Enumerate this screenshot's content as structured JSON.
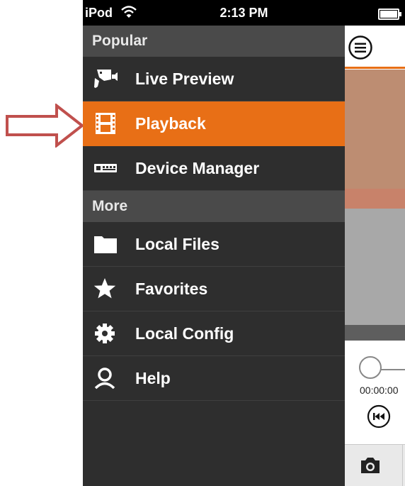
{
  "status_bar": {
    "carrier": "iPod",
    "time": "2:13 PM"
  },
  "menu": {
    "sections": [
      {
        "title": "Popular",
        "items": [
          {
            "label": "Live Preview",
            "icon": "camera-icon",
            "active": false
          },
          {
            "label": "Playback",
            "icon": "film-icon",
            "active": true
          },
          {
            "label": "Device Manager",
            "icon": "dvr-icon",
            "active": false
          }
        ]
      },
      {
        "title": "More",
        "items": [
          {
            "label": "Local Files",
            "icon": "folder-icon",
            "active": false
          },
          {
            "label": "Favorites",
            "icon": "star-icon",
            "active": false
          },
          {
            "label": "Local Config",
            "icon": "gear-icon",
            "active": false
          },
          {
            "label": "Help",
            "icon": "user-icon",
            "active": false
          }
        ]
      }
    ]
  },
  "playback": {
    "time_readout": "00:00:00"
  },
  "colors": {
    "accent": "#e86f16",
    "menu_bg": "#2e2e2e",
    "section_bg": "#4a4a4a",
    "annotation_arrow": "#c0504d"
  }
}
